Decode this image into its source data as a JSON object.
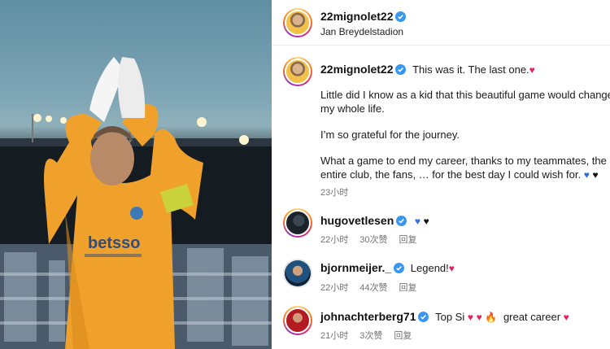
{
  "post": {
    "username": "22mignolet22",
    "location": "Jan Breydelstadion"
  },
  "caption": {
    "username": "22mignolet22",
    "line1": "This was it. The last one.",
    "line2": "Little did I know as a kid that this beautiful game would change",
    "line3": "my whole life.",
    "line4": "I’m so grateful for the journey.",
    "line5": "What a game to end my career, thanks to my teammates, the",
    "line6": "entire club, the fans, … for the best day I could wish for.",
    "time": "23小时"
  },
  "photo": {
    "shirt_text": "betsso"
  },
  "comments": [
    {
      "username": "hugovetlesen",
      "text": "",
      "time": "22小时",
      "likes": "30次赞",
      "reply": "回复"
    },
    {
      "username": "bjornmeijer._",
      "text": "Legend!",
      "time": "22小时",
      "likes": "44次赞",
      "reply": "回复"
    },
    {
      "username": "johnachterberg71",
      "text": "Top Si",
      "text2": "great career",
      "time": "21小时",
      "likes": "3次赞",
      "reply": "回复"
    }
  ],
  "icons": {
    "verified": "verified-badge-icon",
    "heart": "heart-emoji-icon",
    "fire": "fire-emoji-icon"
  },
  "colors": {
    "verified_blue": "#3897f0",
    "heart_pink": "#e0245e",
    "heart_blue": "#2f6fe0",
    "jersey_orange": "#f0a12c"
  }
}
